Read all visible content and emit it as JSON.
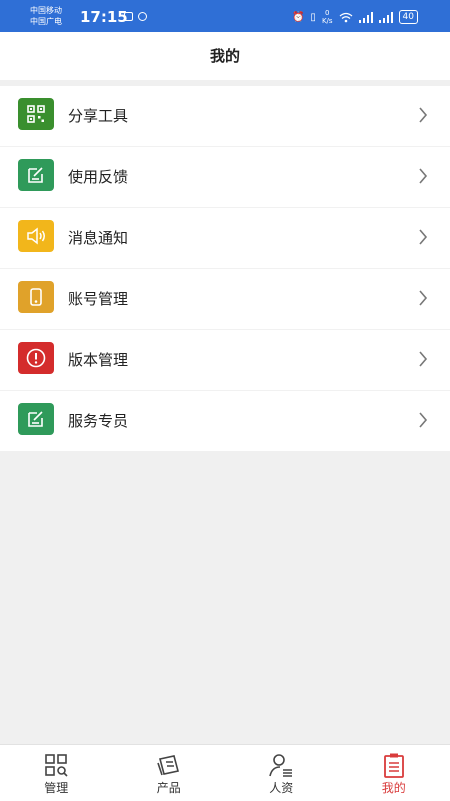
{
  "status_bar": {
    "carrier_1": "中国移动",
    "carrier_2": "中国广电",
    "time": "17:15",
    "net_speed_value": "0",
    "net_speed_unit": "K/s",
    "battery": "40"
  },
  "header": {
    "title": "我的"
  },
  "menu": {
    "items": [
      {
        "label": "分享工具",
        "icon": "qr-code-icon",
        "color": "#3a8f2e"
      },
      {
        "label": "使用反馈",
        "icon": "edit-note-icon",
        "color": "#2f9a5a"
      },
      {
        "label": "消息通知",
        "icon": "speaker-icon",
        "color": "#f2b61b"
      },
      {
        "label": "账号管理",
        "icon": "phone-icon",
        "color": "#e0a22a"
      },
      {
        "label": "版本管理",
        "icon": "alert-icon",
        "color": "#d42c2c"
      },
      {
        "label": "服务专员",
        "icon": "edit-note-icon",
        "color": "#2f9a5a"
      }
    ]
  },
  "tabbar": {
    "tabs": [
      {
        "label": "管理",
        "icon": "grid-search-icon",
        "active": false
      },
      {
        "label": "产品",
        "icon": "product-icon",
        "active": false
      },
      {
        "label": "人资",
        "icon": "person-list-icon",
        "active": false
      },
      {
        "label": "我的",
        "icon": "clipboard-icon",
        "active": true
      }
    ],
    "active_color": "#d93b3b"
  }
}
